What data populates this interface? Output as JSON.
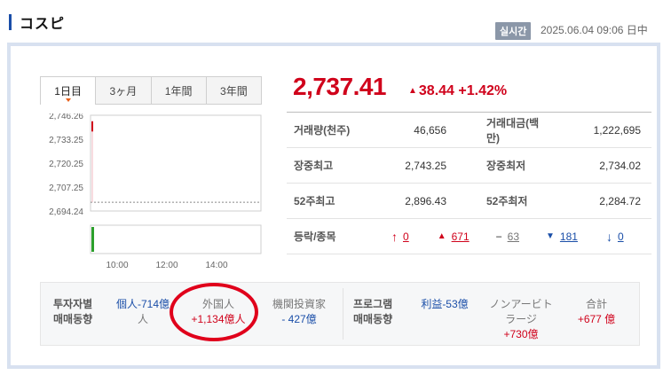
{
  "header": {
    "title": "コスピ",
    "realtime_badge": "실시간",
    "timestamp": "2025.06.04 09:06 日中"
  },
  "tabs": [
    "1日目",
    "3ヶ月",
    "1年間",
    "3年間"
  ],
  "quote": {
    "price": "2,737.41",
    "change_icon": "▲",
    "change": "38.44 +1.42%"
  },
  "stats": {
    "volume_label": "거래량(천주)",
    "volume": "46,656",
    "amount_label": "거래대금(백만)",
    "amount": "1,222,695",
    "high_label": "장중최고",
    "high": "2,743.25",
    "low_label": "장중최저",
    "low": "2,734.02",
    "w52high_label": "52주최고",
    "w52high": "2,896.43",
    "w52low_label": "52주최저",
    "w52low": "2,284.72",
    "updown_label": "등락/종목",
    "upper_limit": "0",
    "up": "671",
    "flat": "63",
    "down": "181",
    "lower_limit": "0"
  },
  "investor": {
    "title_line1": "투자자별",
    "title_line2": "매매동향",
    "individual_line1": "個人-714億",
    "individual_line2": "人",
    "foreign_line1": "外国人",
    "foreign_line2": "+1,134億人",
    "institution_line1": "機関投資家",
    "institution_line2": "- 427億",
    "program_title_line1": "프로그램",
    "program_title_line2": "매매동향",
    "arbitrage": "利益-53億",
    "nonarb_line1": "ノンアービト",
    "nonarb_line2": "ラージ",
    "nonarb_line3": "+730億",
    "total_line1": "合計",
    "total_line2": "+677 億"
  },
  "chart_data": {
    "type": "line",
    "title": "",
    "y_ticks": [
      "2,746.26",
      "2,733.25",
      "2,720.25",
      "2,707.25",
      "2,694.24"
    ],
    "x_ticks": [
      "10:00",
      "12:00",
      "14:00"
    ],
    "ylim": [
      2694.24,
      2746.26
    ],
    "series": [
      {
        "x": [
          "09:00",
          "09:06"
        ],
        "values": [
          2743.0,
          2737.41
        ]
      }
    ],
    "previous_close": 2698.97,
    "colors": {
      "line": "#d0021b",
      "volume": "#2ca02c",
      "prev_close": "#888888"
    }
  }
}
